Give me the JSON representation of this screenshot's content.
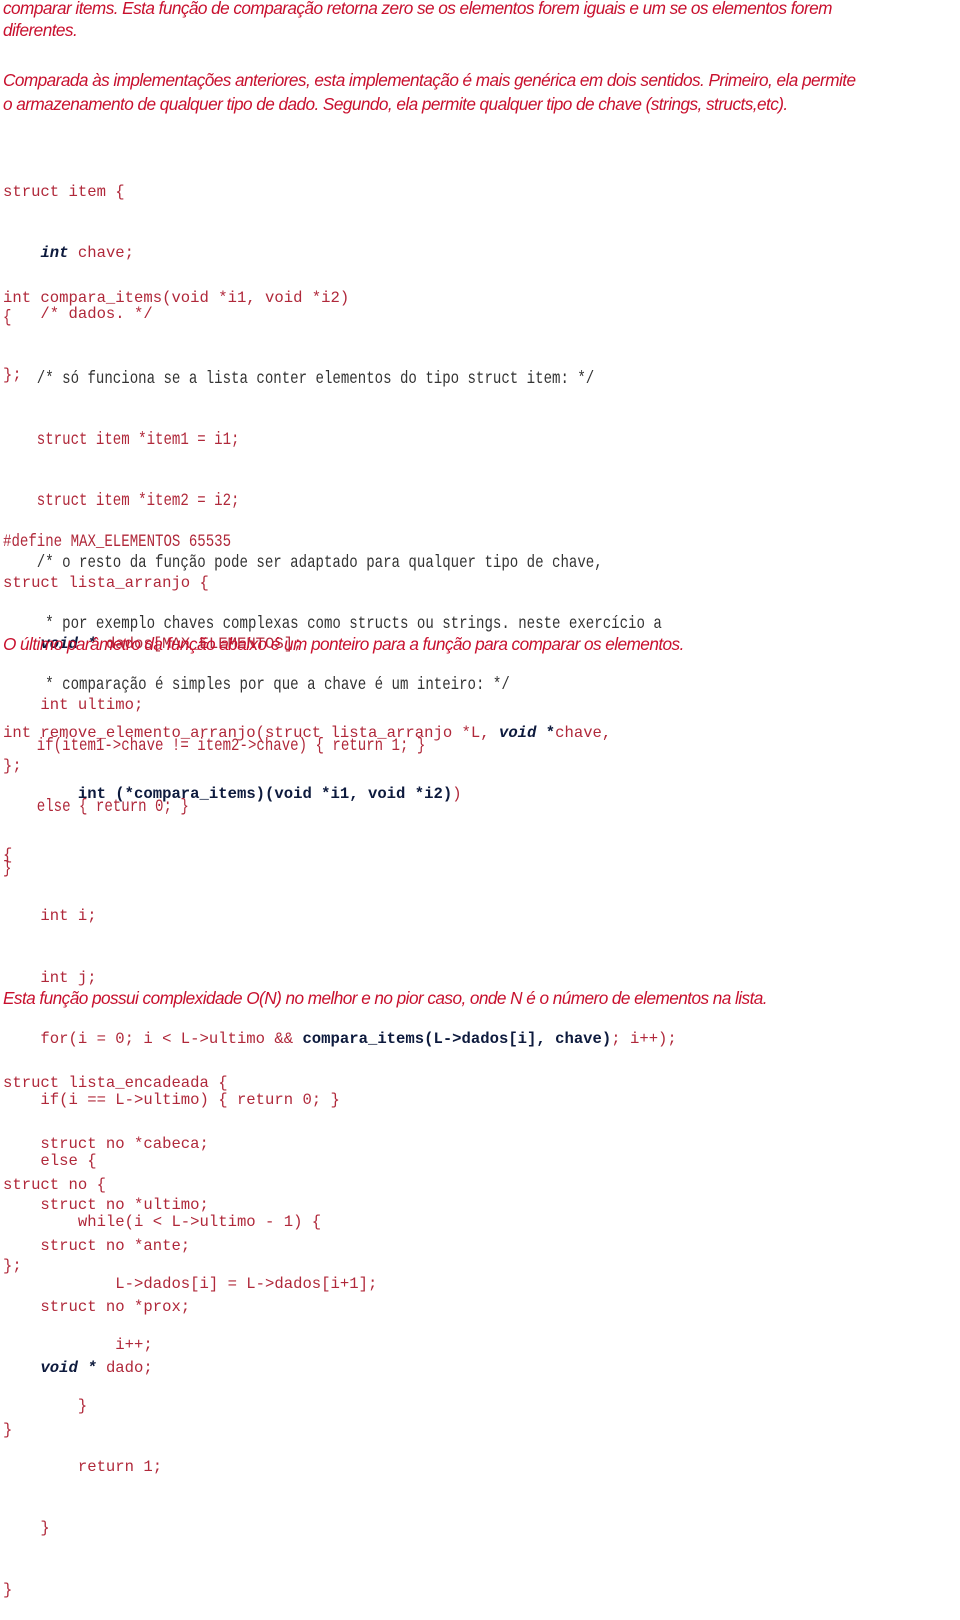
{
  "colors": {
    "prose": "#c8102e",
    "code": "#b0283a",
    "keyword": "#0d1a3d",
    "comment": "#333333"
  },
  "paragraphs": {
    "p1_line1": "comparar items. Esta função de comparação retorna zero se os elementos forem iguais e um se os elementos forem",
    "p1_line2": "diferentes.",
    "p2_line1": "Comparada às implementações anteriores, esta implementação é mais genérica em dois sentidos. Primeiro, ela permite",
    "p2_line2": "o armazenamento de qualquer tipo de dado. Segundo, ela permite qualquer tipo de chave (strings, structs,etc).",
    "p3": "O último parâmetro da função abaixo é um ponteiro para a função para comparar os elementos.",
    "p4": "Esta função possui complexidade O(N) no melhor e no pior caso, onde N é o número de elementos na lista."
  },
  "code_item": {
    "l1": "struct item {",
    "l2_indent": "    ",
    "l2_kw": "int",
    "l2_rest": " chave;",
    "l3": "    /* dados. */",
    "l4": "};"
  },
  "code_compara_sig": "int compara_items(void *i1, void *i2)",
  "code_compara_body": {
    "open": "{",
    "c1": "    /* só funciona se a lista conter elementos do tipo struct item: */",
    "l1": "    struct item *item1 = i1;",
    "l2": "    struct item *item2 = i2;",
    "c2": "    /* o resto da função pode ser adaptado para qualquer tipo de chave,",
    "c3": "     * por exemplo chaves complexas como structs ou strings. neste exercício a",
    "c4": "     * comparação é simples por que a chave é um inteiro: */",
    "l3": "    if(item1->chave != item2->chave) { return 1; }",
    "l4": "    else { return 0; }",
    "close": "}"
  },
  "code_define": "#define MAX_ELEMENTOS 65535",
  "code_arranjo": {
    "l1": "struct lista_arranjo {",
    "l2_indent": "    ",
    "l2_kw": "void *",
    "l2_rest": " dados[MAX_ELEMENTOS];",
    "l3": "    int ultimo;",
    "l4": "};"
  },
  "code_remove": {
    "sig1_a": "int remove_elemento_arranjo(struct lista_arranjo *L, ",
    "sig1_kw": "void",
    "sig1_star": " *",
    "sig1_b": "chave,",
    "sig2_indent": "        ",
    "sig2_fn": "int (*compara_items)(void *i1, void *i2)",
    "sig2_end": ")",
    "open": "{",
    "l1": "    int i;",
    "l2": "    int j;",
    "l3_a": "    for(i = 0; i < L->ultimo && ",
    "l3_fn": "compara_items(L->dados[i], chave)",
    "l3_b": "; i++);",
    "l4": "    if(i == L->ultimo) { return 0; }",
    "l5": "    else {",
    "l6": "        while(i < L->ultimo - 1) {",
    "l7": "            L->dados[i] = L->dados[i+1];",
    "l8": "            i++;",
    "l9": "        }",
    "l10": "        return 1;",
    "l11": "    }",
    "close": "}"
  },
  "code_encadeada": {
    "l1": "struct lista_encadeada {",
    "l2": "    struct no *cabeca;",
    "l3": "    struct no *ultimo;",
    "l4": "};"
  },
  "code_no": {
    "l1": "struct no {",
    "l2": "    struct no *ante;",
    "l3": "    struct no *prox;",
    "l4_indent": "    ",
    "l4_kw": "void *",
    "l4_rest": " dado;",
    "l5": "}"
  }
}
